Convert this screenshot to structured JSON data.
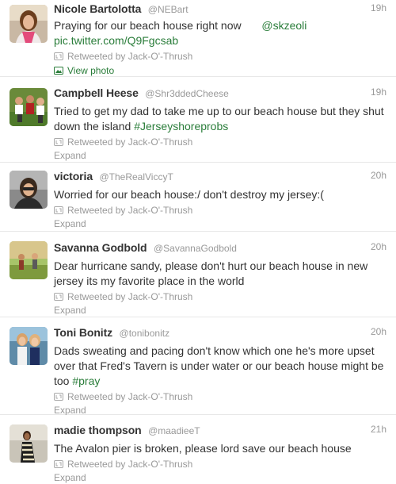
{
  "colors": {
    "link": "#2a7d3a",
    "muted": "#999999",
    "text": "#333333",
    "divider": "#e8e8e8"
  },
  "tweets": [
    {
      "fullname": "Nicole Bartolotta",
      "username": "@NEBart",
      "time": "19h",
      "text_parts": [
        "Praying for our beach house right now",
        "@skzeoli",
        "pic.twitter.com/Q9Fgcsab"
      ],
      "retweeted_by": "Retweeted by Jack-O'-Thrush",
      "action": "View photo",
      "avatar_icon": "avatar-photo"
    },
    {
      "fullname": "Campbell Heese",
      "username": "@Shr3ddedCheese",
      "time": "19h",
      "text_parts": [
        "Tried to get my dad to take me up to our beach house but they shut down the island",
        "#Jerseyshoreprobs"
      ],
      "retweeted_by": "Retweeted by Jack-O'-Thrush",
      "action": "Expand",
      "avatar_icon": "avatar-photo"
    },
    {
      "fullname": "victoria",
      "username": "@TheRealViccyT",
      "time": "20h",
      "text_parts": [
        "Worried for our beach house:/ don't destroy my jersey:("
      ],
      "retweeted_by": "Retweeted by Jack-O'-Thrush",
      "action": "Expand",
      "avatar_icon": "avatar-photo"
    },
    {
      "fullname": "Savanna Godbold",
      "username": "@SavannaGodbold",
      "time": "20h",
      "text_parts": [
        "Dear hurricane sandy, please don't hurt our beach house in new jersey its my favorite place in the world"
      ],
      "retweeted_by": "Retweeted by Jack-O'-Thrush",
      "action": "Expand",
      "avatar_icon": "avatar-photo"
    },
    {
      "fullname": "Toni Bonitz",
      "username": "@tonibonitz",
      "time": "20h",
      "text_parts": [
        "Dads sweating and pacing don't know which one he's more upset over that Fred's Tavern is under water or our beach house might be too",
        "#pray"
      ],
      "retweeted_by": "Retweeted by Jack-O'-Thrush",
      "action": "Expand",
      "avatar_icon": "avatar-photo"
    },
    {
      "fullname": "madie thompson",
      "username": "@maadieeT",
      "time": "21h",
      "text_parts": [
        "The Avalon pier is broken, please lord save our beach house"
      ],
      "retweeted_by": "Retweeted by Jack-O'-Thrush",
      "action": "Expand",
      "avatar_icon": "avatar-photo"
    }
  ]
}
